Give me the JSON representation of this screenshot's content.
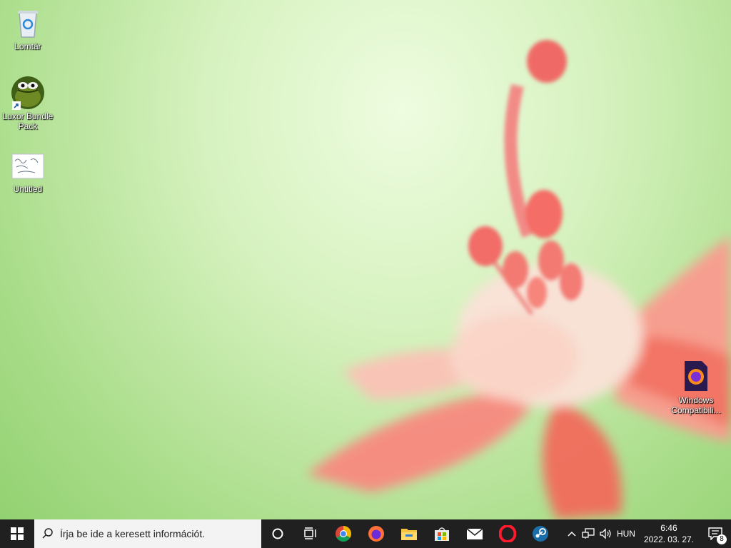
{
  "desktop": {
    "icons": [
      {
        "label": "Lomtár",
        "icon": "recycle-bin-icon"
      },
      {
        "label": "Luxor Bundle Pack",
        "icon": "luxor-game-icon"
      },
      {
        "label": "Untitled",
        "icon": "image-file-icon"
      },
      {
        "label": "Windows Compatibili...",
        "icon": "firefox-document-icon"
      }
    ]
  },
  "taskbar": {
    "search_placeholder": "Írja be ide a keresett információt.",
    "pinned": [
      "cortana-icon",
      "task-view-icon",
      "chrome-icon",
      "firefox-icon",
      "file-explorer-icon",
      "microsoft-store-icon",
      "mail-icon",
      "opera-icon",
      "steam-icon"
    ],
    "tray": {
      "language": "HUN",
      "time": "6:46",
      "date": "2022. 03. 27.",
      "notifications": "8"
    }
  }
}
